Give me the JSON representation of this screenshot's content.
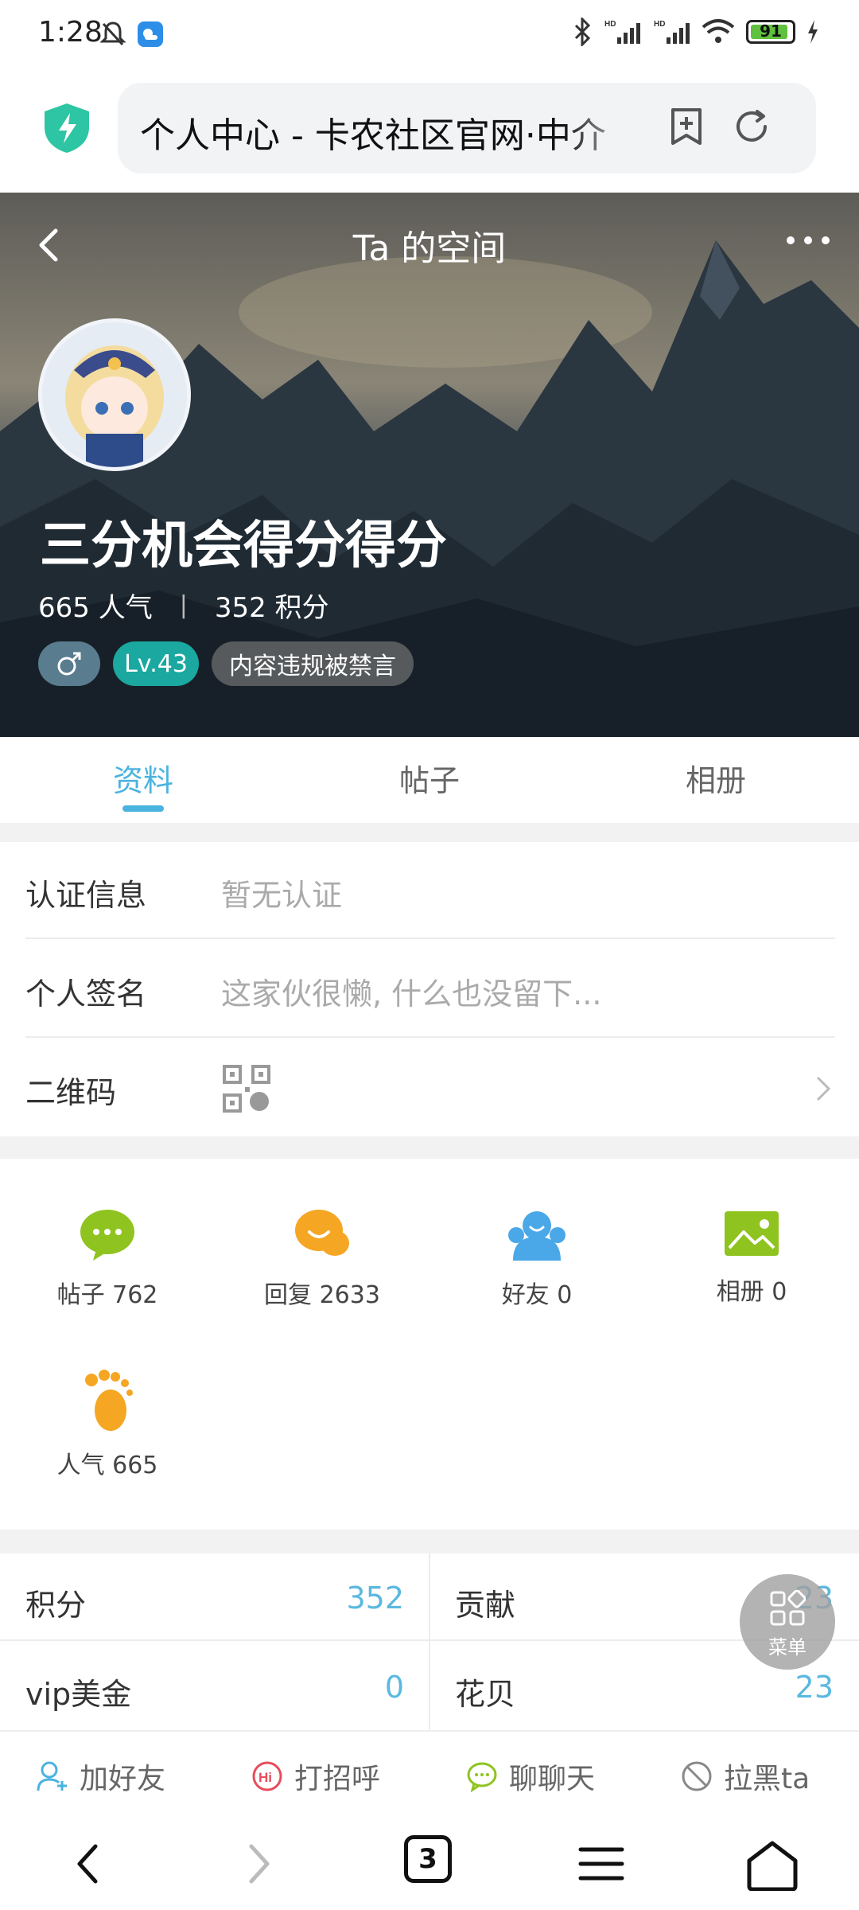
{
  "status_bar": {
    "time": "1:28",
    "battery": "91"
  },
  "browser": {
    "url_title": "个人中心 - 卡农社区官网·中介"
  },
  "hero": {
    "title": "Ta 的空间",
    "username": "三分机会得分得分",
    "popularity": "665 人气",
    "points": "352 积分",
    "level": "Lv.43",
    "ban_badge": "内容违规被禁言",
    "gender_icon": "male-icon"
  },
  "tabs": [
    "资料",
    "帖子",
    "相册"
  ],
  "info": {
    "cert_label": "认证信息",
    "cert_value": "暂无认证",
    "sign_label": "个人签名",
    "sign_value": "这家伙很懒, 什么也没留下...",
    "qr_label": "二维码"
  },
  "grid": {
    "posts": "帖子 762",
    "replies": "回复 2633",
    "friends": "好友 0",
    "albums": "相册 0",
    "popularity": "人气 665"
  },
  "points_table": {
    "score_label": "积分",
    "score_value": "352",
    "contrib_label": "贡献",
    "contrib_value": "23",
    "vip_label": "vip美金",
    "vip_value": "0",
    "flower_label": "花贝",
    "flower_value": "23"
  },
  "fab_label": "菜单",
  "actions": {
    "add_friend": "加好友",
    "greet": "打招呼",
    "chat": "聊聊天",
    "block": "拉黑ta"
  },
  "nav": {
    "tab_count": "3"
  },
  "colors": {
    "accent": "#4ab3e0",
    "level": "#1aa8a0",
    "value": "#5bb8e0"
  }
}
